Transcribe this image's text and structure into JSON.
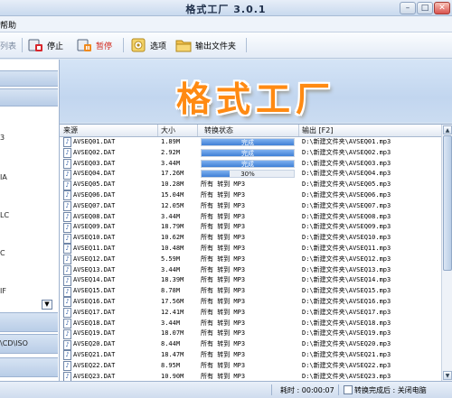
{
  "app": {
    "title": "格式工厂 3.0.1"
  },
  "menu": {
    "help_fragment": "帮助"
  },
  "toolbar": {
    "partial_label": "列表",
    "stop_label": "停止",
    "pause_label": "暂停",
    "options_label": "选项",
    "output_folder_label": "输出文件夹"
  },
  "sidebar": {
    "fragments": [
      "3",
      "IA",
      "LC",
      "C",
      "IF",
      "\\CD\\ISO"
    ]
  },
  "banner": {
    "title": "格式工厂"
  },
  "table": {
    "headers": {
      "source": "来源",
      "size": "大小",
      "status": "转换状态",
      "output": "输出 [F2]"
    },
    "rows": [
      {
        "source": "AVSEQ01.DAT",
        "size": "1.89M",
        "status": "完成",
        "progress": 1.0,
        "output": "D:\\新建文件夹\\AVSEQ01.mp3"
      },
      {
        "source": "AVSEQ02.DAT",
        "size": "2.92M",
        "status": "完成",
        "progress": 1.0,
        "output": "D:\\新建文件夹\\AVSEQ02.mp3"
      },
      {
        "source": "AVSEQ03.DAT",
        "size": "3.44M",
        "status": "完成",
        "progress": 1.0,
        "output": "D:\\新建文件夹\\AVSEQ03.mp3"
      },
      {
        "source": "AVSEQ04.DAT",
        "size": "17.26M",
        "status": "30%",
        "progress": 0.3,
        "output": "D:\\新建文件夹\\AVSEQ04.mp3"
      },
      {
        "source": "AVSEQ05.DAT",
        "size": "10.28M",
        "status": "所有 转到 MP3",
        "output": "D:\\新建文件夹\\AVSEQ05.mp3"
      },
      {
        "source": "AVSEQ06.DAT",
        "size": "15.04M",
        "status": "所有 转到 MP3",
        "output": "D:\\新建文件夹\\AVSEQ06.mp3"
      },
      {
        "source": "AVSEQ07.DAT",
        "size": "12.05M",
        "status": "所有 转到 MP3",
        "output": "D:\\新建文件夹\\AVSEQ07.mp3"
      },
      {
        "source": "AVSEQ08.DAT",
        "size": "3.44M",
        "status": "所有 转到 MP3",
        "output": "D:\\新建文件夹\\AVSEQ08.mp3"
      },
      {
        "source": "AVSEQ09.DAT",
        "size": "18.79M",
        "status": "所有 转到 MP3",
        "output": "D:\\新建文件夹\\AVSEQ09.mp3"
      },
      {
        "source": "AVSEQ10.DAT",
        "size": "10.62M",
        "status": "所有 转到 MP3",
        "output": "D:\\新建文件夹\\AVSEQ10.mp3"
      },
      {
        "source": "AVSEQ11.DAT",
        "size": "10.48M",
        "status": "所有 转到 MP3",
        "output": "D:\\新建文件夹\\AVSEQ11.mp3"
      },
      {
        "source": "AVSEQ12.DAT",
        "size": "5.59M",
        "status": "所有 转到 MP3",
        "output": "D:\\新建文件夹\\AVSEQ12.mp3"
      },
      {
        "source": "AVSEQ13.DAT",
        "size": "3.44M",
        "status": "所有 转到 MP3",
        "output": "D:\\新建文件夹\\AVSEQ13.mp3"
      },
      {
        "source": "AVSEQ14.DAT",
        "size": "18.39M",
        "status": "所有 转到 MP3",
        "output": "D:\\新建文件夹\\AVSEQ14.mp3"
      },
      {
        "source": "AVSEQ15.DAT",
        "size": "8.78M",
        "status": "所有 转到 MP3",
        "output": "D:\\新建文件夹\\AVSEQ15.mp3"
      },
      {
        "source": "AVSEQ16.DAT",
        "size": "17.56M",
        "status": "所有 转到 MP3",
        "output": "D:\\新建文件夹\\AVSEQ16.mp3"
      },
      {
        "source": "AVSEQ17.DAT",
        "size": "12.41M",
        "status": "所有 转到 MP3",
        "output": "D:\\新建文件夹\\AVSEQ17.mp3"
      },
      {
        "source": "AVSEQ18.DAT",
        "size": "3.44M",
        "status": "所有 转到 MP3",
        "output": "D:\\新建文件夹\\AVSEQ18.mp3"
      },
      {
        "source": "AVSEQ19.DAT",
        "size": "18.07M",
        "status": "所有 转到 MP3",
        "output": "D:\\新建文件夹\\AVSEQ19.mp3"
      },
      {
        "source": "AVSEQ20.DAT",
        "size": "8.44M",
        "status": "所有 转到 MP3",
        "output": "D:\\新建文件夹\\AVSEQ20.mp3"
      },
      {
        "source": "AVSEQ21.DAT",
        "size": "18.47M",
        "status": "所有 转到 MP3",
        "output": "D:\\新建文件夹\\AVSEQ21.mp3"
      },
      {
        "source": "AVSEQ22.DAT",
        "size": "8.95M",
        "status": "所有 转到 MP3",
        "output": "D:\\新建文件夹\\AVSEQ22.mp3"
      },
      {
        "source": "AVSEQ23.DAT",
        "size": "10.90M",
        "status": "所有 转到 MP3",
        "output": "D:\\新建文件夹\\AVSEQ23.mp3"
      }
    ]
  },
  "status_bar": {
    "elapsed": "耗时 : 00:00:07",
    "after_done_label": "转换完成后 : 关闭电脑"
  }
}
